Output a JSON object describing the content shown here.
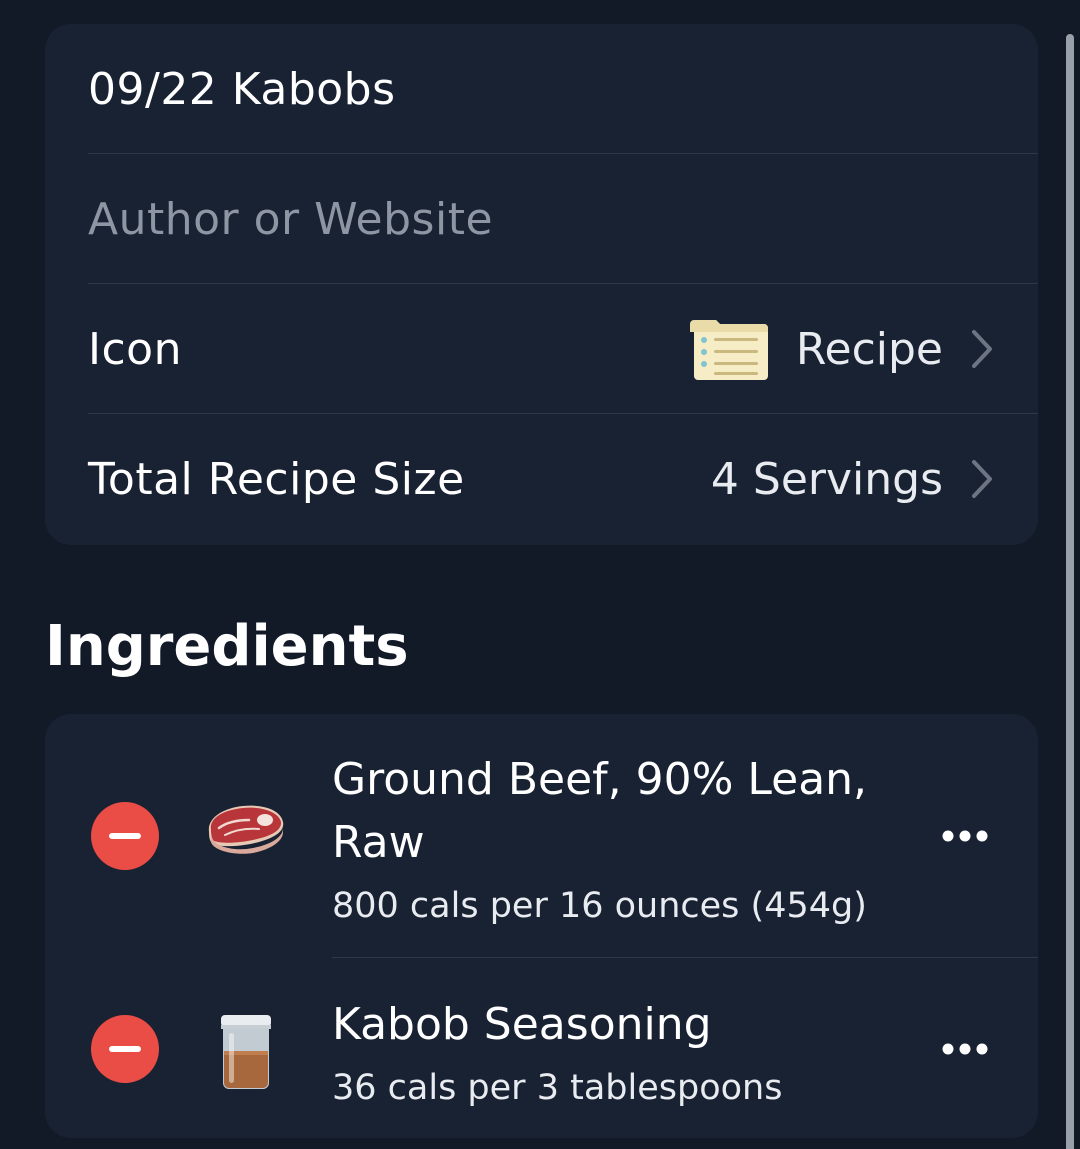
{
  "recipe": {
    "title": "09/22 Kabobs",
    "author_placeholder": "Author or Website",
    "icon_label": "Icon",
    "icon_value": "Recipe",
    "icon_name": "recipe-card-icon",
    "size_label": "Total Recipe Size",
    "size_value": "4 Servings"
  },
  "ingredients": {
    "heading": "Ingredients",
    "items": [
      {
        "name": "Ground Beef, 90% Lean, Raw",
        "detail": "800 cals per 16 ounces (454g)",
        "icon": "steak-icon"
      },
      {
        "name": "Kabob Seasoning",
        "detail": "36 cals per 3 tablespoons",
        "icon": "spice-jar-icon"
      }
    ]
  },
  "colors": {
    "background": "#121a28",
    "card": "#192233",
    "remove": "#ea4d45",
    "placeholder": "#8e96a3"
  }
}
